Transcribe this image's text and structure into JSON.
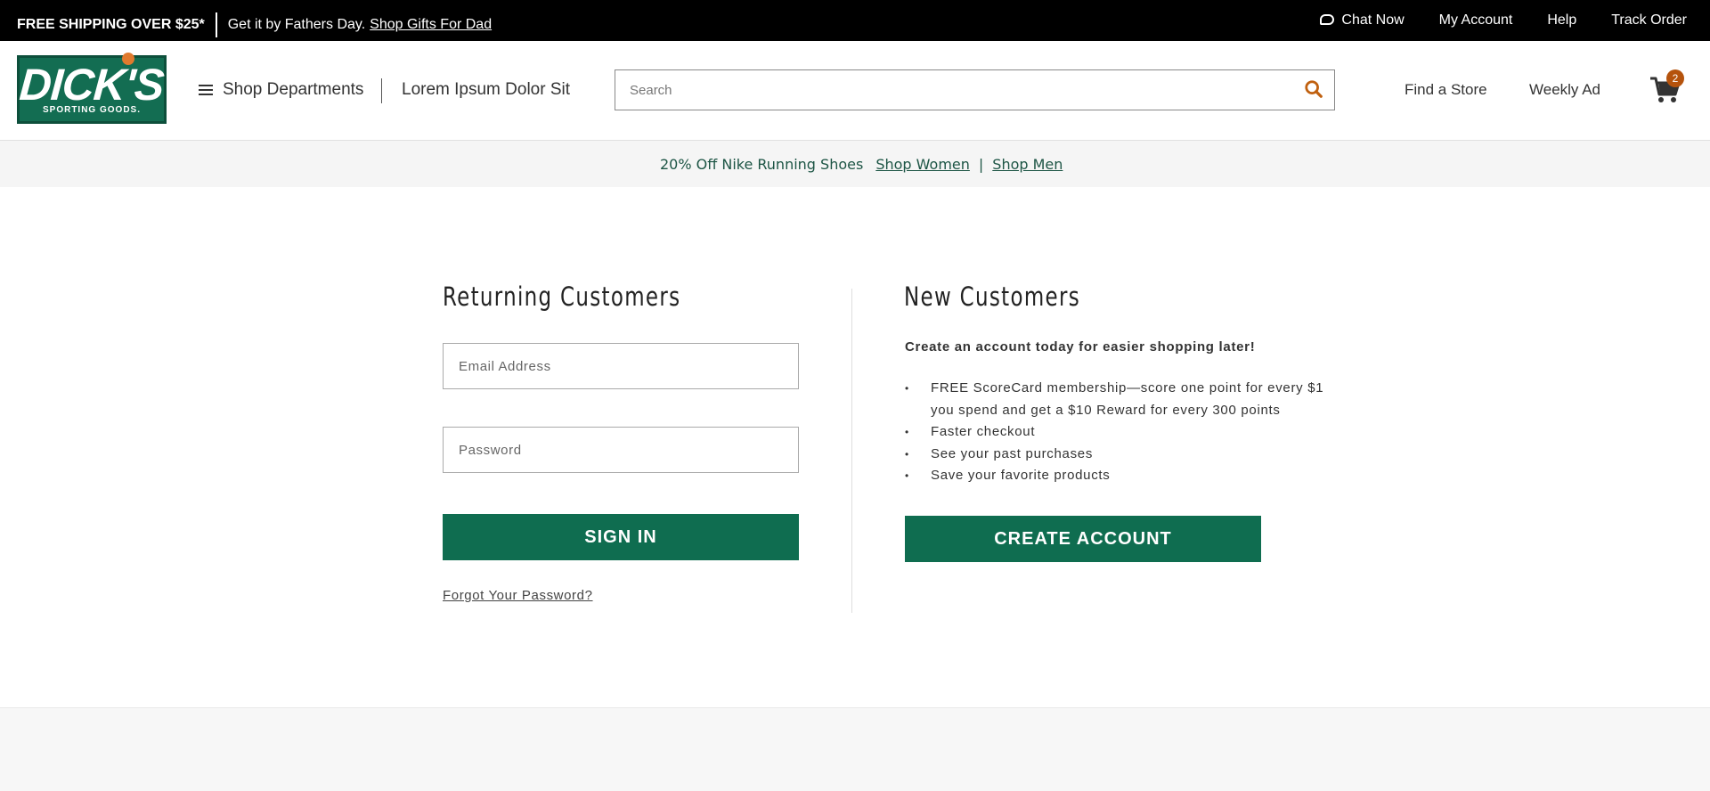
{
  "topbar": {
    "free_shipping_bold": "FREE SHIPPING",
    "free_shipping_rest": " OVER $25*",
    "fathers_day_text": "Get it by Fathers Day.",
    "fathers_day_link": "Shop Gifts For Dad",
    "chat": "Chat Now",
    "account": "My Account",
    "help": "Help",
    "track": "Track Order"
  },
  "header": {
    "logo_main": "DICK'S",
    "logo_sub": "SPORTING GOODS.",
    "shop_departments": "Shop Departments",
    "lorem": "Lorem Ipsum Dolor Sit",
    "search_placeholder": "Search",
    "find_store": "Find a Store",
    "weekly_ad": "Weekly Ad",
    "cart_count": "2"
  },
  "promo_strip": {
    "text": "20% Off Nike Running Shoes",
    "link_women": "Shop Women",
    "separator": "|",
    "link_men": "Shop Men"
  },
  "returning": {
    "title": "Returning Customers",
    "email_placeholder": "Email Address",
    "password_placeholder": "Password",
    "sign_in": "SIGN IN",
    "forgot": "Forgot Your Password?"
  },
  "new_customers": {
    "title": "New Customers",
    "subhead": "Create an account today for easier shopping later!",
    "benefits": [
      "FREE ScoreCard membership—score one point for every $1 you spend and get a $10 Reward for every 300 points",
      "Faster checkout",
      "See your past purchases",
      "Save your favorite products"
    ],
    "create_account": "CREATE ACCOUNT"
  },
  "colors": {
    "brand_green": "#0f6d50",
    "accent_orange": "#c0600f",
    "topbar_bg": "#000000"
  },
  "icons": {
    "chat": "chat-bubble-icon",
    "menu": "hamburger-icon",
    "search": "search-icon",
    "cart": "cart-icon"
  }
}
